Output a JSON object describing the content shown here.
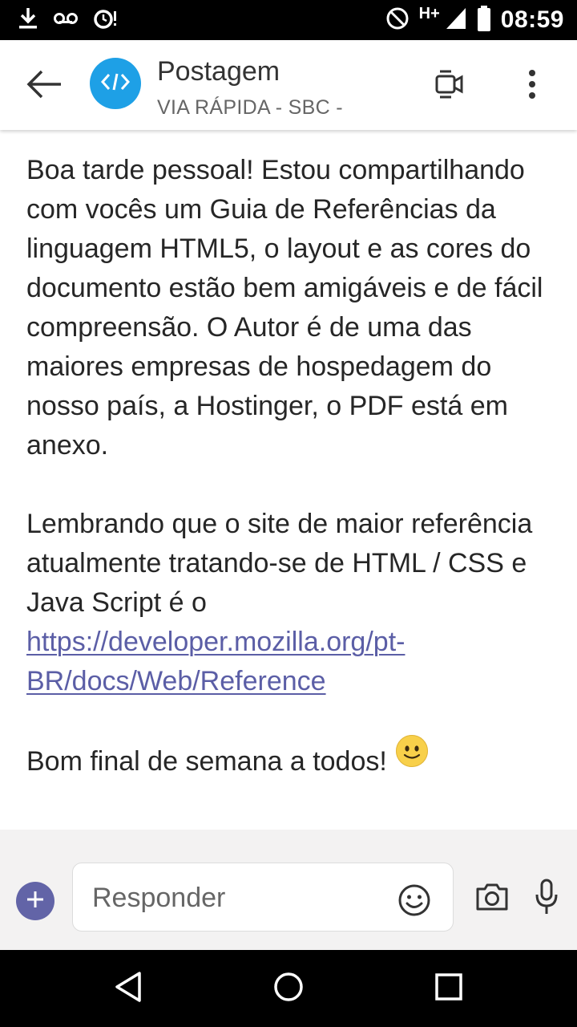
{
  "status_bar": {
    "time": "08:59",
    "network": "H+",
    "icons": [
      "download-icon",
      "voicemail-icon",
      "alarm-icon",
      "do-not-disturb-icon",
      "signal-icon",
      "battery-icon"
    ]
  },
  "header": {
    "title": "Postagem",
    "subtitle": "VIA RÁPIDA - SBC -",
    "avatar_icon": "code-icon",
    "avatar_color": "#1ea0e6",
    "icons": [
      "back-arrow-icon",
      "video-call-icon",
      "more-vertical-icon"
    ]
  },
  "message": {
    "paragraph1": "Boa tarde pessoal! Estou compartilhando com vocês um Guia de Referências da linguagem HTML5, o layout e as cores do documento estão bem amigáveis e de fácil compreensão. O Autor é de uma das maiores empresas de hospedagem do nosso país, a Hostinger, o PDF está em anexo.",
    "paragraph2_text": "Lembrando que o site de maior referência atualmente tratando-se de HTML / CSS e Java Script é o ",
    "link": "https://developer.mozilla.org/pt-BR/docs/Web/Reference",
    "paragraph3": "Bom final de semana a todos!",
    "emoji": "smiley-emoji-icon",
    "link_color": "#5b5ea6"
  },
  "compose": {
    "placeholder": "Responder",
    "accent_color": "#6264a7",
    "icons": [
      "add-icon",
      "emoji-icon",
      "camera-icon",
      "microphone-icon"
    ]
  },
  "nav_bar": {
    "icons": [
      "back-triangle-icon",
      "home-circle-icon",
      "recents-square-icon"
    ]
  }
}
